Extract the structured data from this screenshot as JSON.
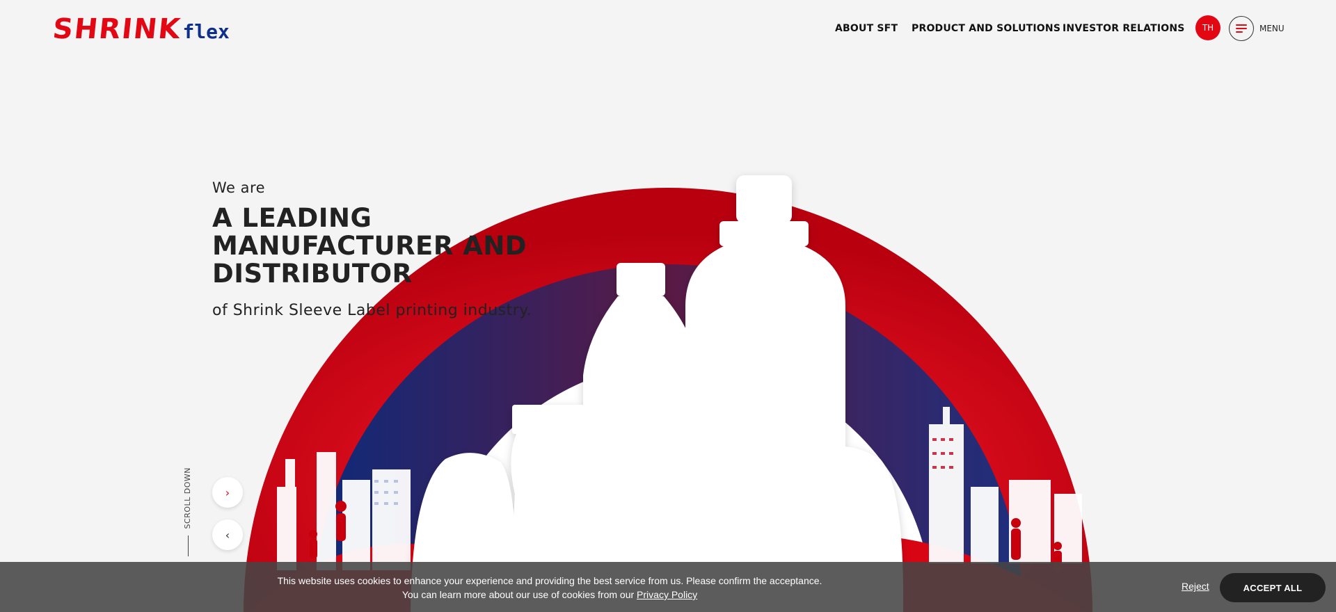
{
  "brand": {
    "logo_main": "SHRINK",
    "logo_sub": "flex"
  },
  "nav": {
    "items": [
      "ABOUT SFT",
      "PRODUCT AND SOLUTIONS",
      "INVESTOR RELATIONS"
    ],
    "lang": "TH",
    "menu_label": "MENU"
  },
  "hero": {
    "intro": "We are",
    "headline": [
      "A LEADING",
      "MANUFACTURER AND",
      "DISTRIBUTOR"
    ],
    "subline": "of Shrink Sleeve Label printing industry."
  },
  "controls": {
    "scroll_label": "SCROLL DOWN",
    "next_icon": "›",
    "prev_icon": "‹"
  },
  "cookie": {
    "line1": "This website uses cookies to enhance your experience and providing the best service from us. Please confirm the acceptance.",
    "line2_prefix": "You can learn more about our use of cookies from our ",
    "policy_link": "Privacy Policy",
    "reject_label": "Reject",
    "accept_label": "ACCEPT ALL"
  },
  "colors": {
    "brand_red": "#e30613",
    "brand_blue": "#0f2f8c",
    "dark": "#222222"
  }
}
